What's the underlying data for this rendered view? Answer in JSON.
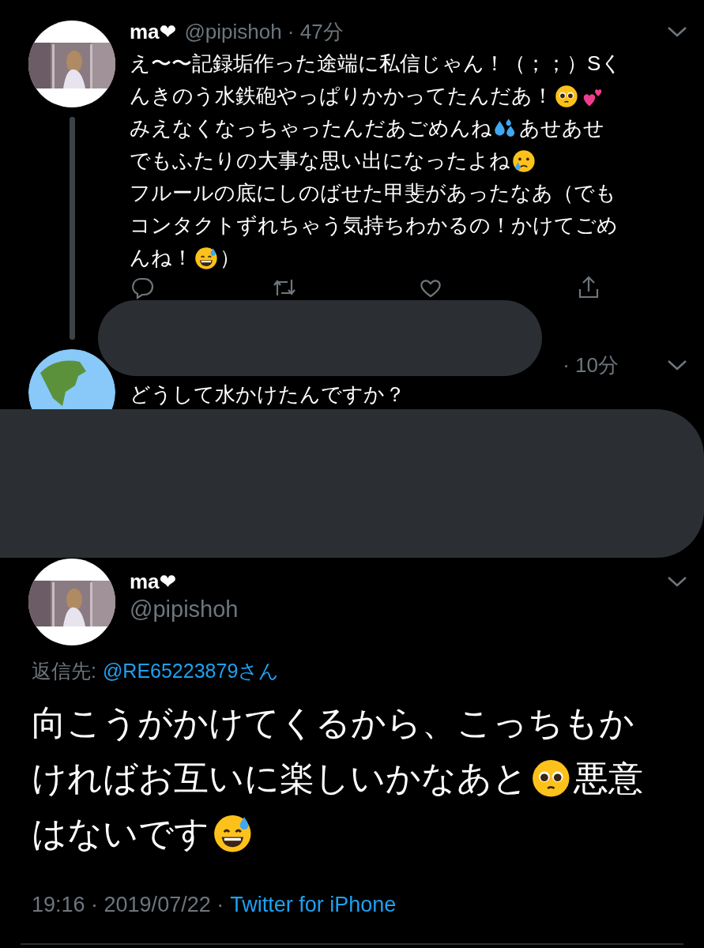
{
  "tweet": {
    "name": "ma❤",
    "meta": "@pipishoh · 47分",
    "lines": [
      [
        {
          "kind": "text",
          "text": "え〜〜記録垢作った途端に私信じゃん！（；；）Sく"
        }
      ],
      [
        {
          "kind": "text",
          "text": "んきのう水鉄砲やっぱりかかってたんだあ！"
        },
        {
          "kind": "pleading"
        },
        {
          "kind": "hearts"
        }
      ],
      [
        {
          "kind": "text",
          "text": "みえなくなっちゃったんだあごめんね"
        },
        {
          "kind": "sweat_drops"
        },
        {
          "kind": "text",
          "text": "あせあせ"
        }
      ],
      [
        {
          "kind": "text",
          "text": "でもふたりの大事な思い出になったよね"
        },
        {
          "kind": "crying"
        }
      ],
      [
        {
          "kind": "text",
          "text": "フルールの底にしのばせた甲斐があったなあ（でも"
        }
      ],
      [
        {
          "kind": "text",
          "text": "コンタクトずれちゃう気持ちわかるの！かけてごめ"
        }
      ],
      [
        {
          "kind": "text",
          "text": "んね！"
        },
        {
          "kind": "grin_sweat"
        },
        {
          "kind": "text",
          "text": "）"
        }
      ]
    ]
  },
  "reply": {
    "meta": "· 10分",
    "body": "どうして水かけたんですか？"
  },
  "focused_tweet": {
    "name": "ma❤",
    "handle": "@pipishoh",
    "reply_label": "返信先:",
    "reply_mention": "@RE65223879さん",
    "lines": [
      [
        {
          "kind": "text",
          "text": "向こうがかけてくるから、こっちもか"
        }
      ],
      [
        {
          "kind": "text",
          "text": "ければお互いに楽しいかなあと"
        },
        {
          "kind": "pleading"
        },
        {
          "kind": "text",
          "text": "悪意"
        }
      ],
      [
        {
          "kind": "text",
          "text": "はないです"
        },
        {
          "kind": "grin_sweat"
        }
      ]
    ],
    "timestamp": "19:16 · 2019/07/22 ·",
    "source": "Twitter for iPhone"
  }
}
